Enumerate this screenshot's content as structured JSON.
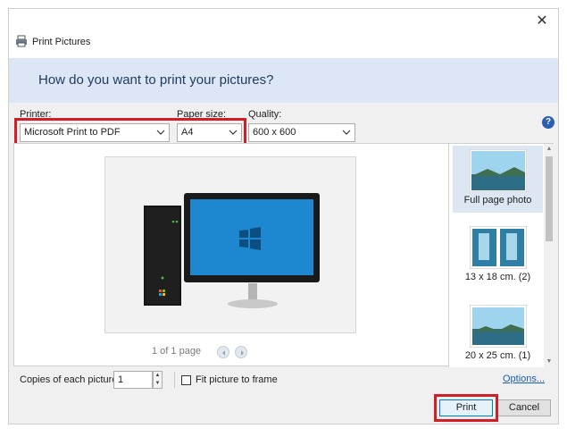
{
  "window": {
    "title": "Print Pictures",
    "close_glyph": "✕"
  },
  "banner": {
    "text": "How do you want to print your pictures?"
  },
  "printer": {
    "label": "Printer:",
    "value": "Microsoft Print to PDF"
  },
  "paper_size": {
    "label": "Paper size:",
    "value": "A4"
  },
  "quality": {
    "label": "Quality:",
    "value": "600 x 600"
  },
  "help": {
    "glyph": "?"
  },
  "preview": {
    "page_info": "1 of 1 page"
  },
  "layouts": [
    {
      "label": "Full page photo",
      "selected": true
    },
    {
      "label": "13 x 18 cm. (2)",
      "selected": false
    },
    {
      "label": "20 x 25 cm. (1)",
      "selected": false
    }
  ],
  "copies": {
    "label": "Copies of each picture:",
    "value": "1"
  },
  "fit": {
    "label": "Fit picture to frame",
    "checked": false
  },
  "options_link": "Options...",
  "buttons": {
    "print": "Print",
    "cancel": "Cancel"
  },
  "colors": {
    "highlight": "#d31e25",
    "banner": "#dce6f4",
    "link": "#1a5fb4"
  }
}
